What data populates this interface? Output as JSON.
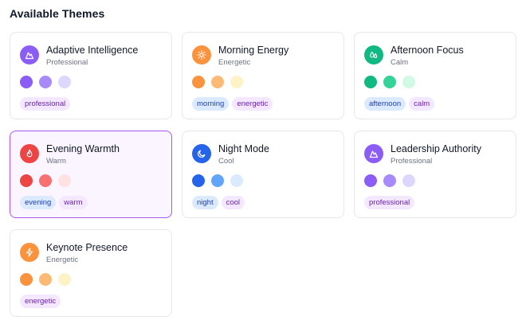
{
  "header": {
    "title": "Available Themes"
  },
  "themes": [
    {
      "name": "Adaptive Intelligence",
      "category": "Professional",
      "icon": "mountain-icon",
      "icon_color": "#8b5cf6",
      "swatches": [
        "#8b5cf6",
        "#a78bfa",
        "#ddd6fe"
      ],
      "tags": [
        {
          "label": "professional",
          "style": "purple"
        }
      ],
      "selected": false
    },
    {
      "name": "Morning Energy",
      "category": "Energetic",
      "icon": "sun-icon",
      "icon_color": "#fb923c",
      "swatches": [
        "#fb923c",
        "#fdba74",
        "#fef3c7"
      ],
      "tags": [
        {
          "label": "morning",
          "style": "blue"
        },
        {
          "label": "energetic",
          "style": "purple"
        }
      ],
      "selected": false
    },
    {
      "name": "Afternoon Focus",
      "category": "Calm",
      "icon": "leaf-drops-icon",
      "icon_color": "#10b981",
      "swatches": [
        "#10b981",
        "#34d399",
        "#d1fae5"
      ],
      "tags": [
        {
          "label": "afternoon",
          "style": "blue"
        },
        {
          "label": "calm",
          "style": "purple"
        }
      ],
      "selected": false
    },
    {
      "name": "Evening Warmth",
      "category": "Warm",
      "icon": "flame-icon",
      "icon_color": "#ef4444",
      "swatches": [
        "#ef4444",
        "#f87171",
        "#fee2e2"
      ],
      "tags": [
        {
          "label": "evening",
          "style": "blue"
        },
        {
          "label": "warm",
          "style": "purple"
        }
      ],
      "selected": true
    },
    {
      "name": "Night Mode",
      "category": "Cool",
      "icon": "moon-icon",
      "icon_color": "#2563eb",
      "swatches": [
        "#2563eb",
        "#60a5fa",
        "#dbeafe"
      ],
      "tags": [
        {
          "label": "night",
          "style": "blue"
        },
        {
          "label": "cool",
          "style": "purple"
        }
      ],
      "selected": false
    },
    {
      "name": "Leadership Authority",
      "category": "Professional",
      "icon": "mountain-icon",
      "icon_color": "#8b5cf6",
      "swatches": [
        "#8b5cf6",
        "#a78bfa",
        "#ddd6fe"
      ],
      "tags": [
        {
          "label": "professional",
          "style": "purple"
        }
      ],
      "selected": false
    },
    {
      "name": "Keynote Presence",
      "category": "Energetic",
      "icon": "zap-icon",
      "icon_color": "#fb923c",
      "swatches": [
        "#fb923c",
        "#fdba74",
        "#fef3c7"
      ],
      "tags": [
        {
          "label": "energetic",
          "style": "purple"
        }
      ],
      "selected": false
    }
  ]
}
